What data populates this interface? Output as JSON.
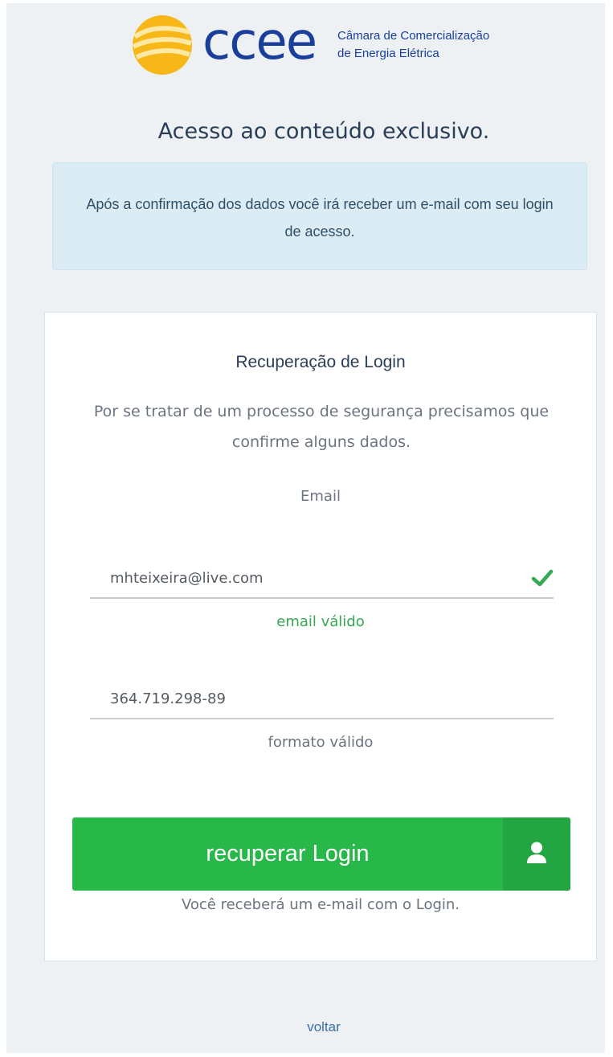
{
  "logo": {
    "name": "ccee",
    "tagline_line1": "Câmara de Comercialização",
    "tagline_line2": "de Energia Elétrica",
    "color": "#1a3f9b",
    "sun_colors": [
      "#f7b718",
      "#fbd54a"
    ]
  },
  "page_title": "Acesso ao conteúdo exclusivo.",
  "info_box": {
    "text": "Após a confirmação dos dados você irá receber um e-mail com seu login de acesso."
  },
  "card": {
    "title": "Recuperação de Login",
    "description": "Por se tratar de um processo de segurança precisamos que confirme alguns dados.",
    "email_label": "Email",
    "email_value": "mhteixeira@live.com",
    "email_hint": "email válido",
    "email_status_icon": "check-icon",
    "cpf_value": "364.719.298-89",
    "cpf_hint": "formato válido",
    "submit_label": "recuperar Login",
    "submit_icon": "user-icon",
    "submit_note": "Você receberá um e-mail com o Login."
  },
  "back_link": "voltar",
  "colors": {
    "background": "#eef1f4",
    "info_box": "#dbecf5",
    "button": "#28b84a",
    "button_icon_area": "#23a642",
    "valid": "#35a853",
    "link": "#3b6ea5"
  }
}
